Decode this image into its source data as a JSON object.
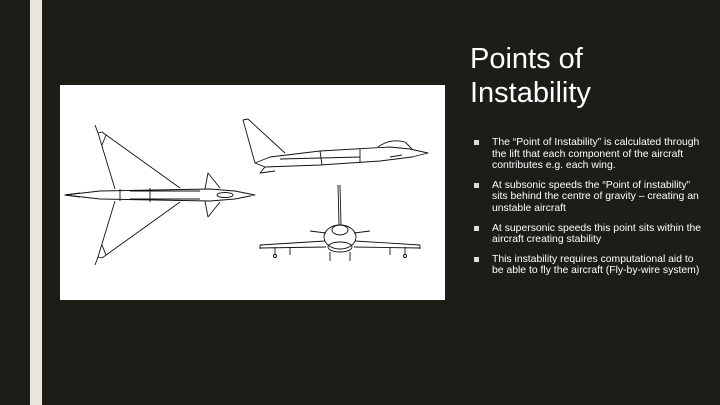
{
  "slide": {
    "title": "Points of Instability",
    "bullets": [
      "The “Point of Instability” is calculated through the lift that each component of the aircraft contributes  e.g. each wing.",
      "At subsonic speeds the  “Point of instability” sits behind the centre of gravity – creating an unstable aircraft",
      "At supersonic speeds this point sits within the aircraft creating stability",
      "This instability requires computational aid to be able to fly the aircraft (Fly-by-wire system)"
    ]
  },
  "image": {
    "subject": "three-view-line-drawing-jet-fighter",
    "views": [
      "top-view",
      "side-view",
      "front-view"
    ]
  },
  "colors": {
    "background": "#1c1d17",
    "accent_bar": "#e9e6dd",
    "text": "#ffffff",
    "bullet_marker": "#dcdcdc"
  }
}
